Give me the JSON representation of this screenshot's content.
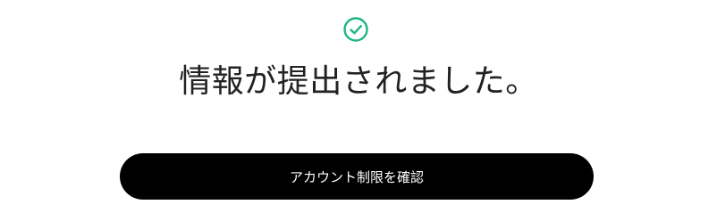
{
  "status": {
    "icon": "check-circle-icon",
    "accent_color": "#1db587"
  },
  "message": {
    "title": "情報が提出されました。"
  },
  "actions": {
    "primary_label": "アカウント制限を確認"
  }
}
